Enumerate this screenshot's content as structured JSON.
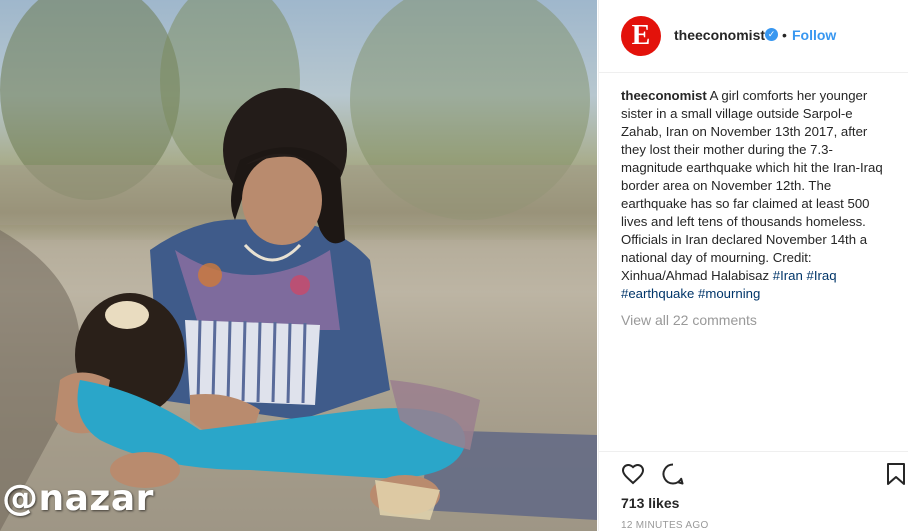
{
  "photo": {
    "alt_icon": "photo",
    "watermark": "@nazar"
  },
  "header": {
    "avatar_letter": "E",
    "username": "theeconomist",
    "verified_icon": "verified-badge-icon",
    "separator": "•",
    "follow_label": "Follow"
  },
  "caption": {
    "username": "theeconomist",
    "text": "A girl comforts her younger sister in a small village outside Sarpol-e Zahab, Iran on November 13th 2017, after they lost their mother during the 7.3-magnitude earthquake which hit the Iran-Iraq border area on November 12th. The earthquake has so far claimed at least 500 lives and left tens of thousands homeless. Officials in Iran declared November 14th a national day of mourning. Credit: Xinhua/Ahmad Halabisaz",
    "tags": [
      "#Iran",
      "#Iraq",
      "#earthquake",
      "#mourning"
    ]
  },
  "comments": {
    "view_all_label": "View all 22 comments"
  },
  "actions": {
    "like_icon": "heart-icon",
    "comment_icon": "comment-icon",
    "save_icon": "bookmark-icon"
  },
  "likes": "713 likes",
  "timestamp": "12 MINUTES AGO",
  "colors": {
    "brand": "#e3120b",
    "link": "#3897f0",
    "hashtag": "#003569",
    "muted": "#999999"
  }
}
